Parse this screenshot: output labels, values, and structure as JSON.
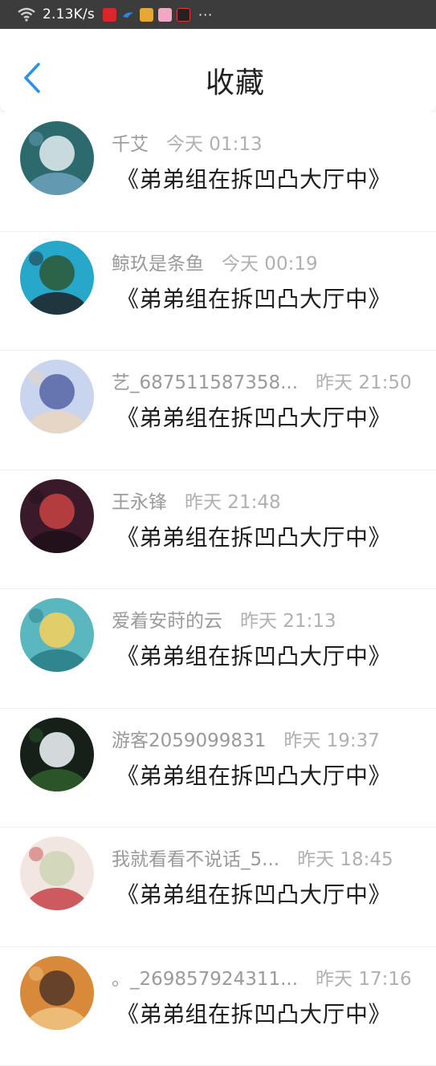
{
  "status_bar": {
    "network_speed": "2.13K/s",
    "icons": [
      "wifi-icon",
      "microphone-icon",
      "bird-icon",
      "game-icon",
      "cat-icon",
      "video-icon"
    ],
    "more": "···"
  },
  "header": {
    "title": "收藏"
  },
  "favorites": [
    {
      "name": "千艾",
      "time": "今天 01:13",
      "book": "《弟弟组在拆凹凸大厅中》",
      "avatar_colors": [
        "#2c6a6e",
        "#d9e7e8",
        "#6aa0b8"
      ]
    },
    {
      "name": "鲸玖是条鱼",
      "time": "今天 00:19",
      "book": "《弟弟组在拆凹凸大厅中》",
      "avatar_colors": [
        "#27a7c9",
        "#2e5d3d",
        "#1f2a30"
      ]
    },
    {
      "name": "艺_687511587358...",
      "time": "昨天 21:50",
      "book": "《弟弟组在拆凹凸大厅中》",
      "avatar_colors": [
        "#c9d4ee",
        "#5b6aa8",
        "#e9d6c0"
      ]
    },
    {
      "name": "王永锋",
      "time": "昨天 21:48",
      "book": "《弟弟组在拆凹凸大厅中》",
      "avatar_colors": [
        "#3a1a2a",
        "#c04040",
        "#201018"
      ]
    },
    {
      "name": "爱着安莳的云",
      "time": "昨天 21:13",
      "book": "《弟弟组在拆凹凸大厅中》",
      "avatar_colors": [
        "#5ab7c0",
        "#f0d060",
        "#2c7f88"
      ]
    },
    {
      "name": "游客2059099831",
      "time": "昨天 19:37",
      "book": "《弟弟组在拆凹凸大厅中》",
      "avatar_colors": [
        "#142018",
        "#e8ecf0",
        "#2e5a2a"
      ]
    },
    {
      "name": "我就看看不说话_5...",
      "time": "昨天 18:45",
      "book": "《弟弟组在拆凹凸大厅中》",
      "avatar_colors": [
        "#f2e6e0",
        "#cfd6b8",
        "#c84a50"
      ]
    },
    {
      "name": "。_269857924311...",
      "time": "昨天 17:16",
      "book": "《弟弟组在拆凹凸大厅中》",
      "avatar_colors": [
        "#d88a3a",
        "#5a3a2a",
        "#f0c080"
      ]
    }
  ]
}
